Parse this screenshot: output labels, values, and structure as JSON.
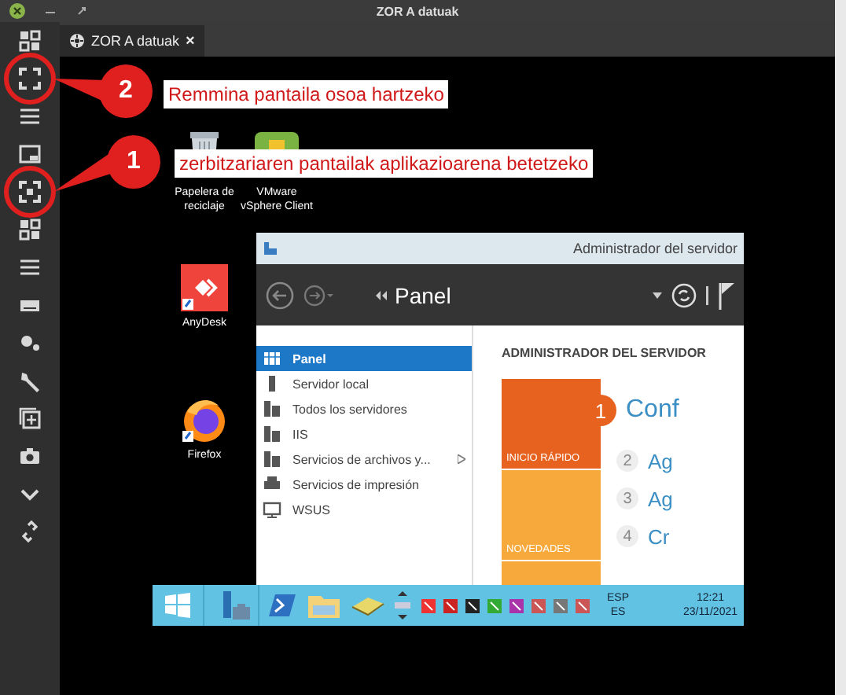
{
  "window": {
    "title": "ZOR A datuak"
  },
  "tabs": [
    {
      "label": "ZOR A datuak",
      "close": "×",
      "selected": true
    }
  ],
  "callouts": [
    {
      "number": "2",
      "text": "Remmina pantaila osoa hartzeko"
    },
    {
      "number": "1",
      "text": "zerbitzariaren pantailak aplikazioarena betetzeko"
    }
  ],
  "remote_desktop": {
    "icons": [
      {
        "kind": "trash",
        "label": "Papelera de reciclaje"
      },
      {
        "kind": "vmware",
        "label": "VMware vSphere Client"
      },
      {
        "kind": "anydesk",
        "label": "AnyDesk"
      },
      {
        "kind": "firefox",
        "label": "Firefox"
      }
    ],
    "server_manager": {
      "title": "Administrador del servidor",
      "breadcrumb": "Panel",
      "nav": [
        {
          "label": "Panel",
          "selected": true
        },
        {
          "label": "Servidor local",
          "selected": false
        },
        {
          "label": "Todos los servidores",
          "selected": false
        },
        {
          "label": "IIS",
          "selected": false
        },
        {
          "label": "Servicios de archivos y...",
          "expandable": true,
          "selected": false
        },
        {
          "label": "Servicios de impresión",
          "selected": false
        },
        {
          "label": "WSUS",
          "selected": false
        }
      ],
      "heading": "ADMINISTRADOR DEL SERVIDOR",
      "tiles": [
        "INICIO RÁPIDO",
        "NOVEDADES"
      ],
      "steps": [
        {
          "number": "1",
          "text": "Conf",
          "current": true
        },
        {
          "number": "2",
          "text": "Ag",
          "current": false
        },
        {
          "number": "3",
          "text": "Ag",
          "current": false
        },
        {
          "number": "4",
          "text": "Cr",
          "current": false
        }
      ]
    },
    "taskbar": {
      "language": "ESP",
      "locale": "ES",
      "time": "12:21",
      "date": "23/11/2021"
    }
  }
}
